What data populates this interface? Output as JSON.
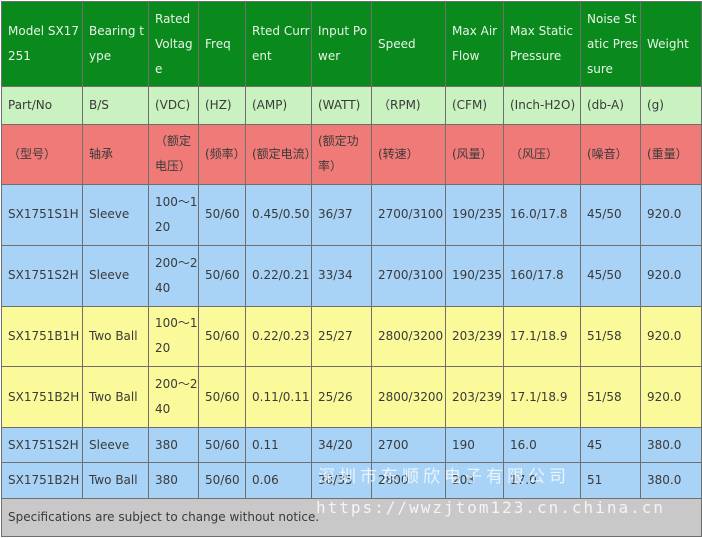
{
  "header": {
    "model": "Model SX17251",
    "bearing": "Bearing type",
    "voltage": "Rated Voltage",
    "freq": "Freq",
    "current": "Rted Current",
    "power": "Input Power",
    "speed": "Speed",
    "airflow": "Max Air Flow",
    "static_pressure": "Max Static Pressure",
    "noise": "Noise Static Pressure",
    "weight": "Weight"
  },
  "units": {
    "model": "Part/No",
    "bearing": "B/S",
    "voltage": "(VDC)",
    "freq": "(HZ)",
    "current": "(AMP)",
    "power": "(WATT)",
    "speed": "（RPM)",
    "airflow": "(CFM)",
    "static_pressure": "(Inch-H2O)",
    "noise": "(db-A)",
    "weight": "(g)"
  },
  "chinese": {
    "model": "（型号）",
    "bearing": "轴承",
    "voltage": "（额定电压）",
    "freq": "(频率）",
    "current": "(额定电流）",
    "power": "(额定功率）",
    "speed": "(转速）",
    "airflow": "(风量）",
    "static_pressure": "（风压）",
    "noise": "(噪音）",
    "weight": "(重量）"
  },
  "rows": [
    {
      "model": "SX1751S1H",
      "bearing": "Sleeve",
      "voltage": "100～120",
      "freq": "50/60",
      "current": "0.45/0.50",
      "power": "36/37",
      "speed": "2700/3100",
      "airflow": "190/235",
      "static_pressure": "16.0/17.8",
      "noise": "45/50",
      "weight": "920.0"
    },
    {
      "model": "SX1751S2H",
      "bearing": "Sleeve",
      "voltage": "200～240",
      "freq": "50/60",
      "current": "0.22/0.21",
      "power": "33/34",
      "speed": "2700/3100",
      "airflow": "190/235",
      "static_pressure": "160/17.8",
      "noise": "45/50",
      "weight": "920.0"
    },
    {
      "model": "SX1751B1H",
      "bearing": "Two Ball",
      "voltage": "100～120",
      "freq": "50/60",
      "current": "0.22/0.23",
      "power": "25/27",
      "speed": "2800/3200",
      "airflow": "203/239",
      "static_pressure": "17.1/18.9",
      "noise": "51/58",
      "weight": "920.0"
    },
    {
      "model": "SX1751B2H",
      "bearing": "Two Ball",
      "voltage": "200～240",
      "freq": "50/60",
      "current": "0.11/0.11",
      "power": "25/26",
      "speed": "2800/3200",
      "airflow": "203/239",
      "static_pressure": "17.1/18.9",
      "noise": "51/58",
      "weight": "920.0"
    },
    {
      "model": "SX1751S2H",
      "bearing": "Sleeve",
      "voltage": "380",
      "freq": "50/60",
      "current": "0.11",
      "power": "34/20",
      "speed": "2700",
      "airflow": "190",
      "static_pressure": "16.0",
      "noise": "45",
      "weight": "380.0"
    },
    {
      "model": "SX1751B2H",
      "bearing": "Two Ball",
      "voltage": "380",
      "freq": "50/60",
      "current": "0.06",
      "power": "38/35",
      "speed": "2800",
      "airflow": "203",
      "static_pressure": "17.0",
      "noise": "51",
      "weight": "380.0"
    }
  ],
  "note": "Specifications are subject to change without notice.",
  "watermark": {
    "company": "深圳市东顺欣电子有限公司",
    "url": "https://wwzjtom123.cn.china.cn"
  },
  "colors": {
    "header_green": "#0a8a1d",
    "units_green": "#c9f2c0",
    "chinese_red": "#f07a78",
    "row_blue": "#a8d3f7",
    "row_yellow": "#fafa9a",
    "note_gray": "#c8c8c8"
  }
}
